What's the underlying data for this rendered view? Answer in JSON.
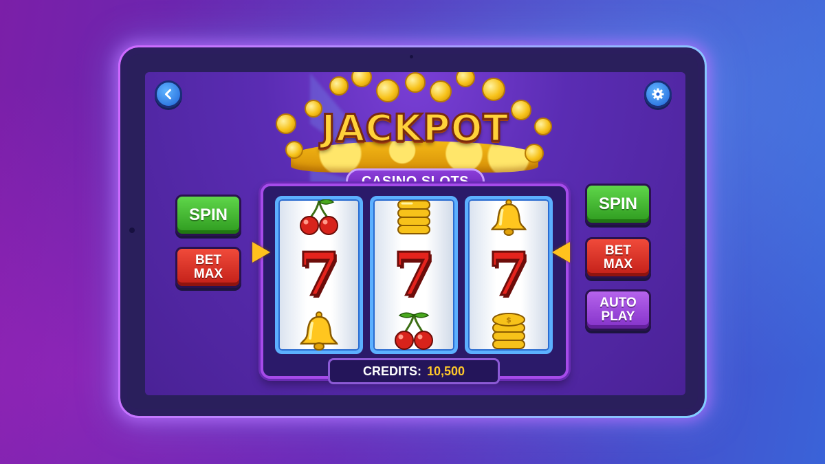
{
  "game": {
    "title": "JACKPOT",
    "subtitle": "CASINO SLOTS"
  },
  "controls": {
    "back_icon": "chevron-left-icon",
    "settings_icon": "gear-icon",
    "left": {
      "spin_label": "SPIN",
      "bet_max_line1": "BET",
      "bet_max_line2": "MAX"
    },
    "right": {
      "spin_label": "SPIN",
      "bet_max_line1": "BET",
      "bet_max_line2": "MAX",
      "auto_play_line1": "AUTO",
      "auto_play_line2": "PLAY"
    }
  },
  "reels": [
    {
      "top": "cherries",
      "middle": "7",
      "bottom": "bell"
    },
    {
      "top": "coin-stack",
      "middle": "7",
      "bottom": "cherries"
    },
    {
      "top": "bell",
      "middle": "7",
      "bottom": "coin-stack"
    }
  ],
  "credits": {
    "label": "CREDITS:",
    "value": "10,500"
  },
  "colors": {
    "accent_gold": "#ffc82a",
    "spin_green": "#3fb52c",
    "bet_red": "#d9281f",
    "auto_purple": "#9a45d8",
    "reel_frame_blue": "#5cb0ff"
  }
}
